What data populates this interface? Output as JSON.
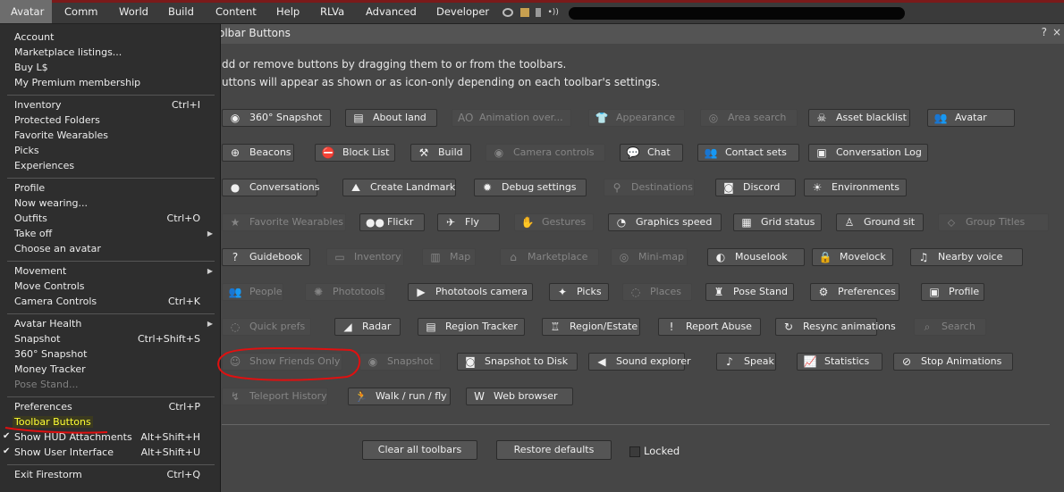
{
  "menubar": {
    "items": [
      "Avatar",
      "Comm",
      "World",
      "Build",
      "Content",
      "Help",
      "RLVa",
      "Advanced",
      "Developer"
    ]
  },
  "window": {
    "title": "olbar Buttons",
    "help": "?",
    "close": "×",
    "line1": "dd or remove buttons by dragging them to or from the toolbars.",
    "line2": "uttons will appear as shown or as icon-only depending on each toolbar's settings."
  },
  "buttons": [
    {
      "label": "360° Snapshot",
      "icon": "camera-icon",
      "enabled": true
    },
    {
      "label": "About land",
      "icon": "sign-icon",
      "enabled": true
    },
    {
      "label": "Animation over...",
      "icon": "ao-icon",
      "enabled": false
    },
    {
      "label": "Appearance",
      "icon": "shirt-icon",
      "enabled": false
    },
    {
      "label": "Area search",
      "icon": "radar-search-icon",
      "enabled": false
    },
    {
      "label": "Asset blacklist",
      "icon": "skull-icon",
      "enabled": true
    },
    {
      "label": "Avatar",
      "icon": "people-icon",
      "enabled": true
    },
    {
      "label": "Beacons",
      "icon": "crosshair-icon",
      "enabled": true
    },
    {
      "label": "Block List",
      "icon": "block-icon",
      "enabled": true
    },
    {
      "label": "Build",
      "icon": "hammer-icon",
      "enabled": true
    },
    {
      "label": "Camera controls",
      "icon": "eye-icon",
      "enabled": false
    },
    {
      "label": "Chat",
      "icon": "speech-bubble-icon",
      "enabled": true
    },
    {
      "label": "Contact sets",
      "icon": "contacts-icon",
      "enabled": true
    },
    {
      "label": "Conversation Log",
      "icon": "log-icon",
      "enabled": true
    },
    {
      "label": "Conversations",
      "icon": "bubble-icon",
      "enabled": true
    },
    {
      "label": "Create Landmark",
      "icon": "landmark-icon",
      "enabled": true
    },
    {
      "label": "Debug settings",
      "icon": "bug-icon",
      "enabled": true
    },
    {
      "label": "Destinations",
      "icon": "pin-icon",
      "enabled": false
    },
    {
      "label": "Discord",
      "icon": "discord-icon",
      "enabled": true
    },
    {
      "label": "Environments",
      "icon": "sun-icon",
      "enabled": true
    },
    {
      "label": "Favorite Wearables",
      "icon": "star-icon",
      "enabled": false
    },
    {
      "label": "Flickr",
      "icon": "flickr-icon",
      "enabled": true
    },
    {
      "label": "Fly",
      "icon": "plane-icon",
      "enabled": true
    },
    {
      "label": "Gestures",
      "icon": "hands-icon",
      "enabled": false
    },
    {
      "label": "Graphics speed",
      "icon": "gauge-icon",
      "enabled": true
    },
    {
      "label": "Grid status",
      "icon": "grid-icon",
      "enabled": true
    },
    {
      "label": "Ground sit",
      "icon": "sit-icon",
      "enabled": true
    },
    {
      "label": "Group Titles",
      "icon": "tag-icon",
      "enabled": false
    },
    {
      "label": "Guidebook",
      "icon": "book-icon",
      "enabled": true
    },
    {
      "label": "Inventory",
      "icon": "box-icon",
      "enabled": false
    },
    {
      "label": "Map",
      "icon": "map-icon",
      "enabled": false
    },
    {
      "label": "Marketplace",
      "icon": "store-icon",
      "enabled": false
    },
    {
      "label": "Mini-map",
      "icon": "minimap-icon",
      "enabled": false
    },
    {
      "label": "Mouselook",
      "icon": "mouse-icon",
      "enabled": true
    },
    {
      "label": "Movelock",
      "icon": "lock-icon",
      "enabled": true
    },
    {
      "label": "Nearby voice",
      "icon": "headset-icon",
      "enabled": true
    },
    {
      "label": "People",
      "icon": "people-icon",
      "enabled": false
    },
    {
      "label": "Phototools",
      "icon": "aperture-icon",
      "enabled": false
    },
    {
      "label": "Phototools camera",
      "icon": "video-camera-icon",
      "enabled": true
    },
    {
      "label": "Picks",
      "icon": "pick-icon",
      "enabled": true
    },
    {
      "label": "Places",
      "icon": "places-icon",
      "enabled": false
    },
    {
      "label": "Pose Stand",
      "icon": "pose-icon",
      "enabled": true
    },
    {
      "label": "Preferences",
      "icon": "gears-icon",
      "enabled": true
    },
    {
      "label": "Profile",
      "icon": "id-card-icon",
      "enabled": true
    },
    {
      "label": "Quick prefs",
      "icon": "quick-prefs-icon",
      "enabled": false
    },
    {
      "label": "Radar",
      "icon": "radar-icon",
      "enabled": true
    },
    {
      "label": "Region Tracker",
      "icon": "tracker-icon",
      "enabled": true
    },
    {
      "label": "Region/Estate",
      "icon": "castle-icon",
      "enabled": true
    },
    {
      "label": "Report Abuse",
      "icon": "alert-icon",
      "enabled": true
    },
    {
      "label": "Resync animations",
      "icon": "resync-icon",
      "enabled": true
    },
    {
      "label": "Search",
      "icon": "search-icon",
      "enabled": false
    },
    {
      "label": "Show Friends Only",
      "icon": "friends-icon",
      "enabled": false
    },
    {
      "label": "Snapshot",
      "icon": "camera-icon",
      "enabled": false
    },
    {
      "label": "Snapshot to Disk",
      "icon": "camera-disk-icon",
      "enabled": true
    },
    {
      "label": "Sound explorer",
      "icon": "speaker-icon",
      "enabled": true
    },
    {
      "label": "Speak",
      "icon": "microphone-icon",
      "enabled": true
    },
    {
      "label": "Statistics",
      "icon": "chart-icon",
      "enabled": true
    },
    {
      "label": "Stop Animations",
      "icon": "stop-icon",
      "enabled": true
    },
    {
      "label": "Teleport History",
      "icon": "teleport-icon",
      "enabled": false
    },
    {
      "label": "Walk / run / fly",
      "icon": "walk-icon",
      "enabled": true
    },
    {
      "label": "Web browser",
      "icon": "www-icon",
      "enabled": true
    }
  ],
  "footer": {
    "clear": "Clear all toolbars",
    "restore": "Restore defaults",
    "locked": "Locked"
  },
  "menu": {
    "groups": [
      [
        {
          "label": "Account"
        },
        {
          "label": "Marketplace listings..."
        },
        {
          "label": "Buy L$"
        },
        {
          "label": "My Premium membership"
        }
      ],
      [
        {
          "label": "Inventory",
          "shortcut": "Ctrl+I"
        },
        {
          "label": "Protected Folders"
        },
        {
          "label": "Favorite Wearables"
        },
        {
          "label": "Picks"
        },
        {
          "label": "Experiences"
        }
      ],
      [
        {
          "label": "Profile"
        },
        {
          "label": "Now wearing..."
        },
        {
          "label": "Outfits",
          "shortcut": "Ctrl+O"
        },
        {
          "label": "Take off",
          "submenu": true
        },
        {
          "label": "Choose an avatar"
        }
      ],
      [
        {
          "label": "Movement",
          "submenu": true
        },
        {
          "label": "Move Controls"
        },
        {
          "label": "Camera Controls",
          "shortcut": "Ctrl+K"
        }
      ],
      [
        {
          "label": "Avatar Health",
          "submenu": true
        },
        {
          "label": "Snapshot",
          "shortcut": "Ctrl+Shift+S"
        },
        {
          "label": "360° Snapshot"
        },
        {
          "label": "Money Tracker"
        },
        {
          "label": "Pose Stand...",
          "disabled": true
        }
      ],
      [
        {
          "label": "Preferences",
          "shortcut": "Ctrl+P"
        },
        {
          "label": "Toolbar Buttons",
          "highlighted": true
        },
        {
          "label": "Show HUD Attachments",
          "shortcut": "Alt+Shift+H",
          "checked": true
        },
        {
          "label": "Show User Interface",
          "shortcut": "Alt+Shift+U",
          "checked": true
        }
      ],
      [
        {
          "label": "Exit Firestorm",
          "shortcut": "Ctrl+Q"
        }
      ]
    ]
  },
  "colors": {
    "highlight_text": "#ffff33",
    "annotation_red": "#e01010"
  }
}
